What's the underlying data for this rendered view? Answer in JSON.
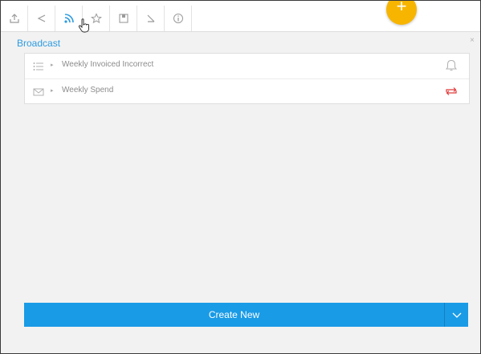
{
  "toolbar": {
    "tools": [
      {
        "icon": "export-icon"
      },
      {
        "icon": "share-icon"
      },
      {
        "icon": "broadcast-icon"
      },
      {
        "icon": "star-icon"
      },
      {
        "icon": "save-icon"
      },
      {
        "icon": "annotate-icon"
      },
      {
        "icon": "info-icon"
      }
    ],
    "fab_icon": "plus-icon",
    "fab_label": "+",
    "fab_color": "#f7b500"
  },
  "panel": {
    "title": "Broadcast",
    "close_label": "×",
    "accent_color": "#2d9be0"
  },
  "broadcasts": [
    {
      "label": "Weekly Invoiced Incorrect",
      "icon": "list-icon",
      "action_icon": "bell-icon",
      "caret": "▸"
    },
    {
      "label": "Weekly Spend",
      "icon": "envelope-icon",
      "action_icon": "repeat-icon",
      "caret": "▸"
    }
  ],
  "create": {
    "label": "Create New",
    "button_color": "#1a9be6",
    "dropdown_icon": "chevron-down-icon"
  }
}
